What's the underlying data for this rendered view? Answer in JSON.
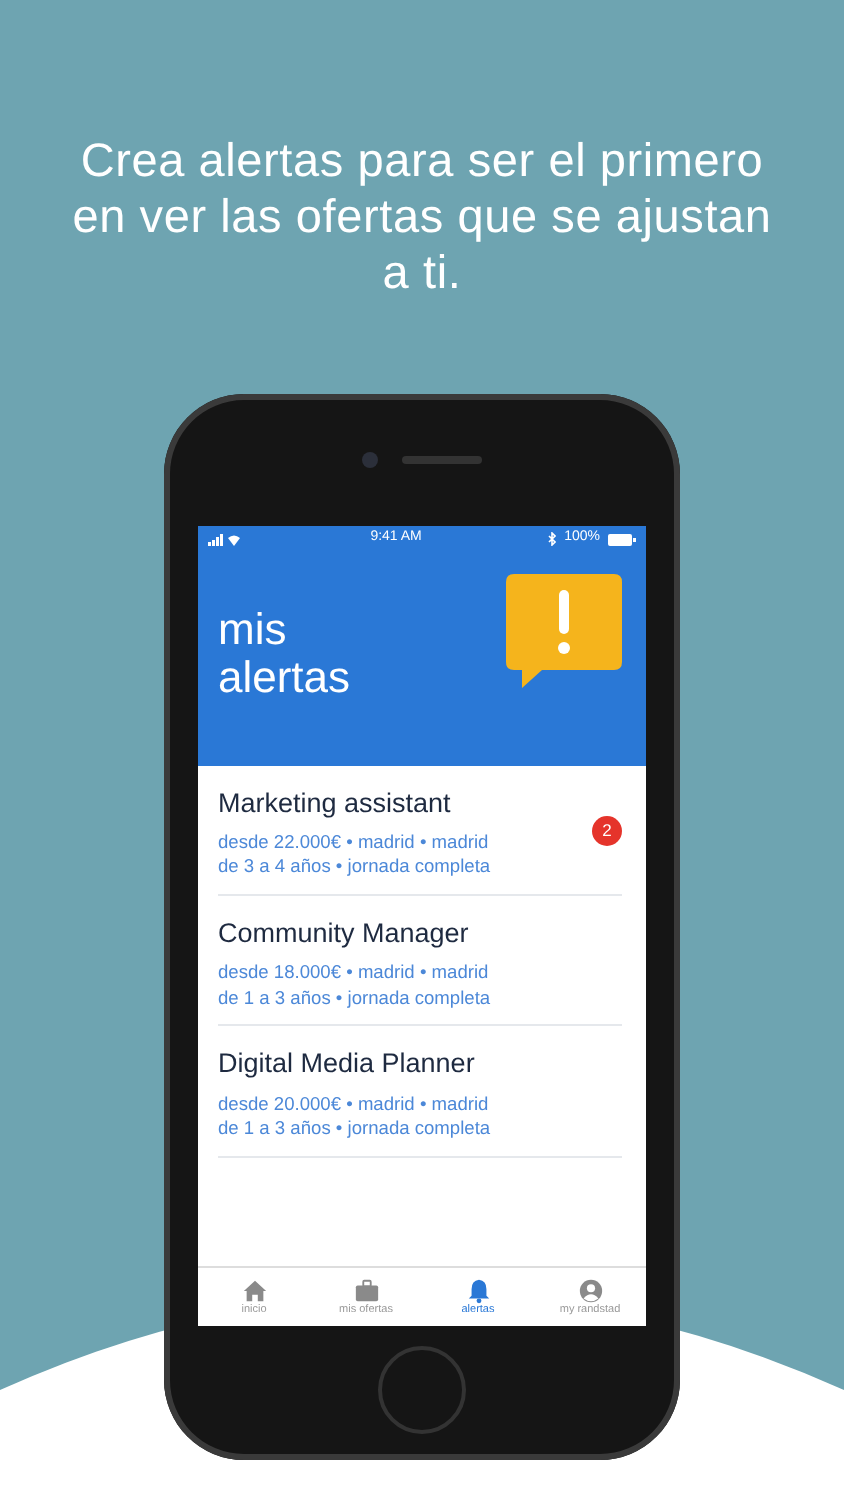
{
  "headline": "Crea alertas para ser el primero en ver las ofertas que se ajustan a ti.",
  "status_bar": {
    "time": "9:41 AM",
    "battery": "100%"
  },
  "header": {
    "title": "mis alertas"
  },
  "alerts": [
    {
      "title": "Marketing assistant",
      "details": [
        "desde 22.000€ • madrid • madrid",
        "de 3 a 4 años • jornada completa"
      ],
      "badge": "2"
    },
    {
      "title": "Community Manager",
      "details": [
        "desde 18.000€ • madrid • madrid",
        "de 1 a 3 años • jornada completa"
      ]
    },
    {
      "title": "Digital Media Planner",
      "details": [
        "desde 20.000€ • madrid • madrid",
        "de 1 a 3 años • jornada completa"
      ]
    }
  ],
  "tabs": [
    {
      "kind": "home",
      "label": "inicio",
      "selected": false
    },
    {
      "kind": "briefcase",
      "label": "mis ofertas",
      "selected": false
    },
    {
      "kind": "bell",
      "label": "alertas",
      "selected": true
    },
    {
      "kind": "profile",
      "label": "my randstad",
      "selected": false
    }
  ]
}
